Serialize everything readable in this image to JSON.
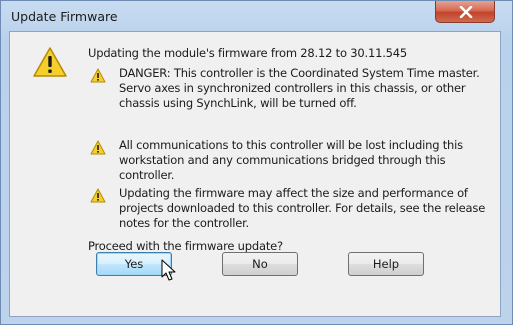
{
  "window": {
    "title": "Update Firmware"
  },
  "icons": {
    "close": "close-icon",
    "main": "warning-icon",
    "item": "warning-icon"
  },
  "colors": {
    "warning_fill": "#f7cf2a",
    "close_button": "#c8452c",
    "default_button_border": "#3c7fb1"
  },
  "message": {
    "intro": "Updating the module's firmware from 28.12 to 30.11.545",
    "warnings": [
      {
        "lines": [
          "DANGER: This controller is the Coordinated System Time master.",
          "Servo axes in synchronized controllers in this chassis, or other",
          "chassis using SynchLink, will be turned off."
        ]
      },
      {
        "lines": [
          "All communications to this controller will be lost including this",
          "workstation and any communications bridged through this controller."
        ]
      },
      {
        "lines": [
          "Updating the firmware may affect the size and performance of",
          "projects downloaded to this controller.  For details, see the release",
          "notes for the controller."
        ]
      }
    ],
    "prompt": "Proceed with the firmware update?"
  },
  "buttons": {
    "yes": "Yes",
    "no": "No",
    "help": "Help"
  }
}
